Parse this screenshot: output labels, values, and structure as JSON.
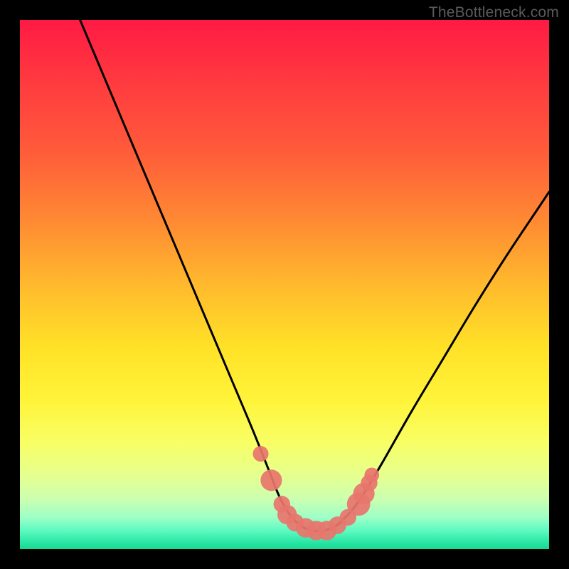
{
  "watermark": "TheBottleneck.com",
  "colors": {
    "frame": "#000000",
    "curve": "#000000",
    "marker_fill": "#e8756c",
    "marker_stroke": "#e8756c",
    "gradient_stops": [
      {
        "offset": 0.0,
        "color": "#ff1a44"
      },
      {
        "offset": 0.12,
        "color": "#ff3b3f"
      },
      {
        "offset": 0.25,
        "color": "#ff5c3a"
      },
      {
        "offset": 0.38,
        "color": "#ff8a33"
      },
      {
        "offset": 0.5,
        "color": "#ffb92d"
      },
      {
        "offset": 0.62,
        "color": "#ffe227"
      },
      {
        "offset": 0.72,
        "color": "#fff43a"
      },
      {
        "offset": 0.8,
        "color": "#f8ff66"
      },
      {
        "offset": 0.86,
        "color": "#e6ff8e"
      },
      {
        "offset": 0.905,
        "color": "#ccffb0"
      },
      {
        "offset": 0.94,
        "color": "#9effc6"
      },
      {
        "offset": 0.965,
        "color": "#5dfac0"
      },
      {
        "offset": 0.985,
        "color": "#2ee8a8"
      },
      {
        "offset": 1.0,
        "color": "#17d98f"
      }
    ]
  },
  "chart_data": {
    "type": "line",
    "title": "",
    "xlabel": "",
    "ylabel": "",
    "xlim": [
      0,
      100
    ],
    "ylim": [
      0,
      100
    ],
    "grid": false,
    "annotations": [
      "TheBottleneck.com"
    ],
    "series": [
      {
        "name": "bottleneck-curve",
        "x": [
          0,
          4,
          8,
          12,
          16,
          20,
          24,
          28,
          32,
          36,
          40,
          44,
          47,
          49,
          51,
          53,
          55,
          57,
          59,
          61,
          64,
          68,
          74,
          80,
          86,
          92,
          98,
          100
        ],
        "y": [
          128,
          118,
          108,
          98.5,
          89,
          79.5,
          70,
          60.5,
          51,
          41.5,
          32,
          22.5,
          15,
          10,
          6.5,
          4.5,
          3.5,
          3.5,
          4,
          5.5,
          9,
          15.5,
          26,
          36,
          46,
          55.5,
          64.5,
          67.5
        ]
      }
    ],
    "markers": [
      {
        "x": 45.5,
        "y": 18,
        "r": 1.2
      },
      {
        "x": 47.5,
        "y": 13,
        "r": 1.8
      },
      {
        "x": 49.5,
        "y": 8.5,
        "r": 1.3
      },
      {
        "x": 50.5,
        "y": 6.5,
        "r": 1.6
      },
      {
        "x": 52,
        "y": 5,
        "r": 1.4
      },
      {
        "x": 54,
        "y": 4,
        "r": 1.6
      },
      {
        "x": 56,
        "y": 3.5,
        "r": 1.6
      },
      {
        "x": 58,
        "y": 3.5,
        "r": 1.6
      },
      {
        "x": 60,
        "y": 4.5,
        "r": 1.4
      },
      {
        "x": 62,
        "y": 6,
        "r": 1.3
      },
      {
        "x": 64,
        "y": 8.5,
        "r": 2.0
      },
      {
        "x": 65,
        "y": 10.5,
        "r": 1.8
      },
      {
        "x": 66,
        "y": 12.5,
        "r": 1.3
      },
      {
        "x": 66.5,
        "y": 14,
        "r": 1.1
      }
    ]
  }
}
